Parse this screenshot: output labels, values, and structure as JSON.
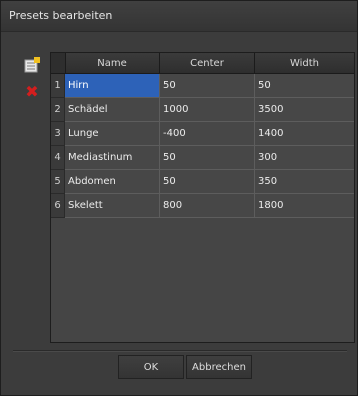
{
  "window": {
    "title": "Presets bearbeiten"
  },
  "toolbar": {
    "add_icon": "add-row-icon",
    "delete_icon": "delete-row-icon",
    "delete_color": "#d41e1e"
  },
  "table": {
    "columns": [
      "Name",
      "Center",
      "Width"
    ],
    "rows": [
      {
        "num": "1",
        "name": "Hirn",
        "center": "50",
        "width": "50",
        "selected": true
      },
      {
        "num": "2",
        "name": "Schädel",
        "center": "1000",
        "width": "3500"
      },
      {
        "num": "3",
        "name": "Lunge",
        "center": "-400",
        "width": "1400"
      },
      {
        "num": "4",
        "name": "Mediastinum",
        "center": "50",
        "width": "300"
      },
      {
        "num": "5",
        "name": "Abdomen",
        "center": "50",
        "width": "350"
      },
      {
        "num": "6",
        "name": "Skelett",
        "center": "800",
        "width": "1800"
      }
    ]
  },
  "buttons": {
    "ok": "OK",
    "cancel": "Abbrechen"
  },
  "colors": {
    "selection": "#2d62b8",
    "background": "#3c3c3c"
  }
}
